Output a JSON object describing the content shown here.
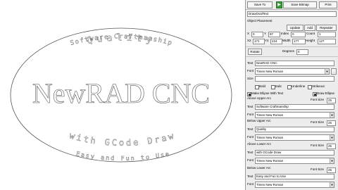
{
  "canvas": {
    "main_text": "NewRAD CNC",
    "arc_top_outer": "Software Craftmanship",
    "arc_top_inner": "Quality",
    "arc_bottom_inner": "with GCode Draw",
    "arc_bottom_outer": "Easy and Fun to Use"
  },
  "toolbar": {
    "save_to": "Save To",
    "save_bitmap": "Save Bitmap",
    "print": "Print",
    "green_icon": "play-icon"
  },
  "panel": {
    "mode_value": "DrawOvalText",
    "object_placement_label": "Object Placement",
    "update_btn": "Update",
    "add_btn": "Add",
    "repeater_btn": "Repeater",
    "row1": {
      "x_label": "X",
      "x_value": "0",
      "y_label": "Y",
      "y_value": "97",
      "index_label": "Index",
      "index_value": "0",
      "count_label": "Count",
      "count_value": "1"
    },
    "row2": {
      "x2_label": "X2",
      "x2_value": "171",
      "y2_label": "Y2",
      "y2_value": "224",
      "width_label": "Width",
      "width_value": "177",
      "height_label": "Height",
      "height_value": "127"
    },
    "rotate_btn": "Rotate",
    "degrees_label": "Degrees",
    "degrees_value": "0",
    "text_label": "Text",
    "text_value": "NewRAD CNC",
    "font_label": "Font",
    "font_value": "Times New Roman",
    "size_label": "Size",
    "bold_label": "Bold",
    "italic_label": "Italic",
    "underline_label": "Underline",
    "strikeout_label": "Strikeout",
    "make_ellipse_label": "Make Ellipse With Text",
    "draw_ellipse_label": "Draw Ellipse",
    "above_upper_arc": "Above Upper Arc",
    "below_upper_arc": "Below Upper Arc",
    "above_lower_arc": "Above Lower Arc",
    "below_lower_arc": "Below Lower Arc",
    "font_size_label": "Font Size",
    "arc1": {
      "font_size": "25",
      "text": "Software Craftmanship",
      "font": "Times New Roman"
    },
    "arc2": {
      "font_size": "25",
      "text": "Quality",
      "font": "Times New Roman"
    },
    "arc3": {
      "font_size": "25",
      "text": "with GCode Draw",
      "font": "Times New Roman"
    },
    "arc4": {
      "font_size": "25",
      "text": "Easy and Fun to Use",
      "font": "Times New Roman"
    }
  },
  "colors": {
    "panel_bg": "#ececec",
    "canvas_bg": "#ffffff",
    "outline": "#555555",
    "accent_green": "#3a9a3a"
  }
}
